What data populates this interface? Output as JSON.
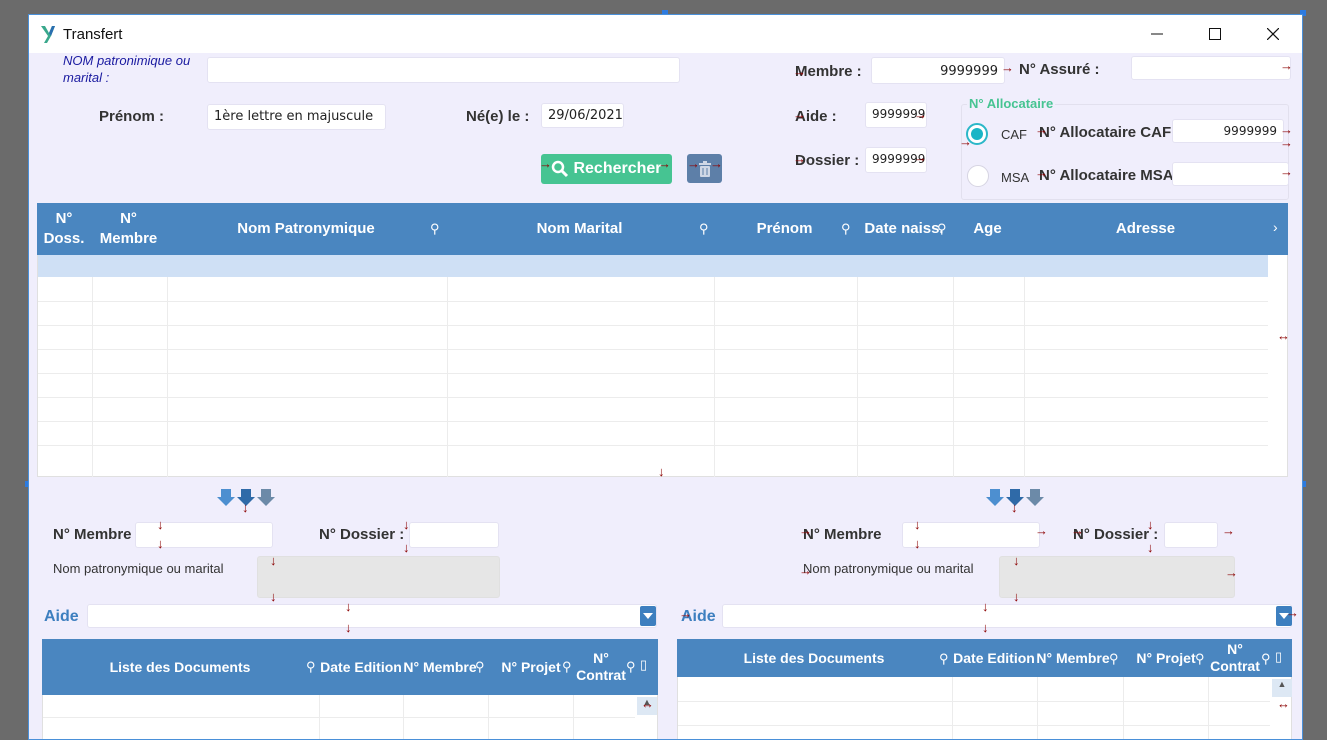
{
  "window": {
    "title": "Transfert"
  },
  "search": {
    "nom_label": "NOM patronimique ou marital :",
    "nom_value": "",
    "prenom_label": "Prénom :",
    "prenom_value": "1ère lettre en majuscule",
    "ne_le_label": "Né(e) le :",
    "ne_le_value": "29/06/2021",
    "membre_label": "Membre :",
    "membre_value": "9999999",
    "assure_label": "N° Assuré :",
    "assure_value": "",
    "aide_label": "Aide :",
    "aide_value": "9999999",
    "dossier_label": "Dossier :",
    "dossier_value": "9999999",
    "rechercher_label": "Rechercher",
    "allocataire": {
      "group_label": "N° Allocataire",
      "caf_option": "CAF",
      "caf_label": "N° Allocataire CAF",
      "caf_value": "9999999",
      "msa_option": "MSA",
      "msa_label": "N° Allocataire MSA",
      "msa_value": "",
      "selected": "CAF"
    }
  },
  "main_grid": {
    "columns": [
      {
        "label": "N° Doss."
      },
      {
        "label": "N° Membre"
      },
      {
        "label": "Nom Patronymique"
      },
      {
        "label": "Nom Marital"
      },
      {
        "label": "Prénom"
      },
      {
        "label": "Date naiss."
      },
      {
        "label": "Age"
      },
      {
        "label": "Adresse"
      }
    ],
    "row_count": 9
  },
  "left_panel": {
    "membre_label": "N° Membre",
    "membre_value": "",
    "dossier_label": "N° Dossier :",
    "dossier_value": "",
    "nom_label": "Nom patronymique ou marital",
    "nom_value": "",
    "aide_label": "Aide",
    "aide_value": "",
    "doc_columns": [
      {
        "label": "Liste des Documents"
      },
      {
        "label": "Date Edition"
      },
      {
        "label": "N° Membre"
      },
      {
        "label": "N° Projet"
      },
      {
        "label": "N° Contrat"
      }
    ]
  },
  "right_panel": {
    "membre_label": "N° Membre",
    "membre_value": "",
    "dossier_label": "N° Dossier :",
    "dossier_value": "",
    "nom_label": "Nom patronymique ou marital",
    "nom_value": "",
    "aide_label": "Aide",
    "aide_value": "",
    "doc_columns": [
      {
        "label": "Liste des Documents"
      },
      {
        "label": "Date Edition"
      },
      {
        "label": "N° Membre"
      },
      {
        "label": "N° Projet"
      },
      {
        "label": "N° Contrat"
      }
    ]
  },
  "colors": {
    "header_blue": "#4a86c0",
    "accent_green": "#46c492",
    "selected_row": "#cfe0f5",
    "window_bg": "#f0eefc"
  }
}
